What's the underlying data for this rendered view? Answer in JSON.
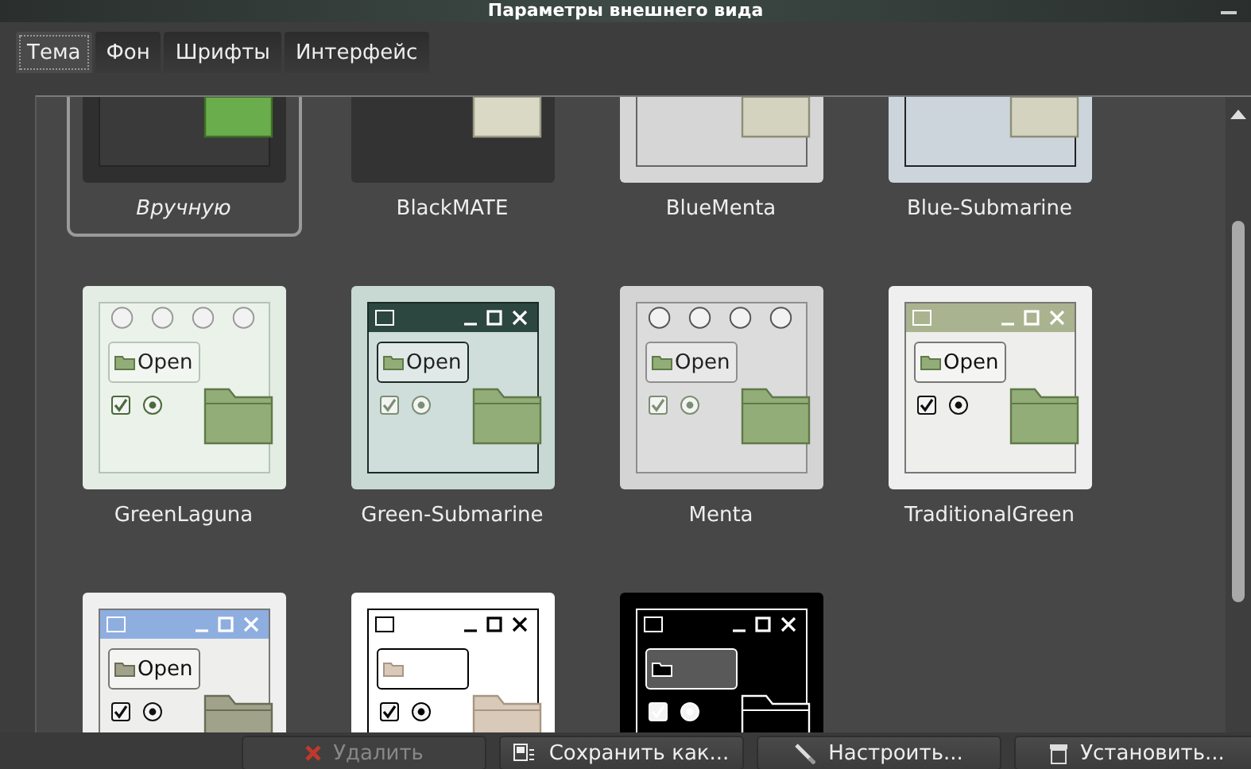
{
  "window": {
    "title": "Параметры внешнего вида"
  },
  "tabs": [
    {
      "label": "Тема",
      "selected": true
    },
    {
      "label": "Фон",
      "selected": false
    },
    {
      "label": "Шрифты",
      "selected": false
    },
    {
      "label": "Интерфейс",
      "selected": false
    }
  ],
  "themes": [
    {
      "name": "Вручную",
      "kind": "custom",
      "selected": true
    },
    {
      "name": "BlackMATE",
      "kind": "black-mate",
      "selected": false
    },
    {
      "name": "BlueMenta",
      "kind": "blue-menta",
      "selected": false
    },
    {
      "name": "Blue-Submarine",
      "kind": "blue-submarine",
      "selected": false
    },
    {
      "name": "GreenLaguna",
      "kind": "green-laguna",
      "selected": false,
      "open_label": "Open"
    },
    {
      "name": "Green-Submarine",
      "kind": "green-submarine",
      "selected": false,
      "open_label": "Open"
    },
    {
      "name": "Menta",
      "kind": "menta",
      "selected": false,
      "open_label": "Open"
    },
    {
      "name": "TraditionalGreen",
      "kind": "traditional-green",
      "selected": false,
      "open_label": "Open"
    },
    {
      "kind": "traditional-blue",
      "selected": false,
      "open_label": "Open"
    },
    {
      "kind": "contrast-white",
      "selected": false
    },
    {
      "kind": "contrast-black",
      "selected": false
    }
  ],
  "buttons": [
    {
      "label": "Удалить",
      "kind": "delete",
      "disabled": true
    },
    {
      "label": "Сохранить как...",
      "kind": "save",
      "disabled": false
    },
    {
      "label": "Настроить...",
      "kind": "customize",
      "disabled": false
    },
    {
      "label": "Установить...",
      "kind": "install",
      "disabled": false
    }
  ]
}
